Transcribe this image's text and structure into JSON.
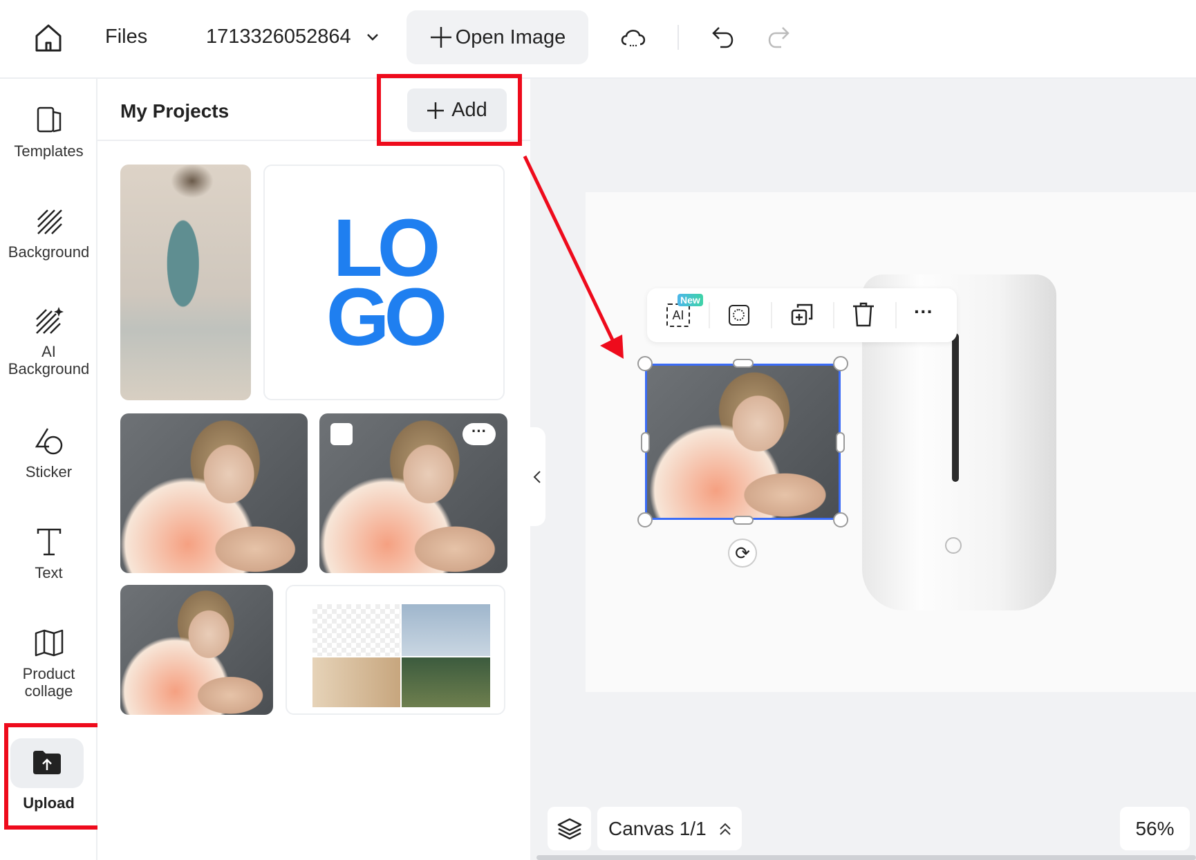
{
  "topbar": {
    "files": "Files",
    "project_name": "1713326052864",
    "open_image": "Open Image"
  },
  "sidebar": {
    "items": [
      {
        "label": "Templates",
        "icon": "templates-icon"
      },
      {
        "label": "Background",
        "icon": "background-icon"
      },
      {
        "label": "AI\nBackground",
        "l1": "AI",
        "l2": "Background",
        "icon": "ai-background-icon"
      },
      {
        "label": "Sticker",
        "icon": "sticker-icon"
      },
      {
        "label": "Text",
        "icon": "text-icon"
      },
      {
        "label": "Product collage",
        "l1": "Product",
        "l2": "collage",
        "icon": "product-collage-icon"
      },
      {
        "label": "Upload",
        "icon": "upload-icon",
        "active": true
      }
    ]
  },
  "panel": {
    "title": "My Projects",
    "add_label": "Add",
    "logo_text": [
      "LO",
      "GO"
    ]
  },
  "toolbar": {
    "new_badge": "New",
    "ai_label": "AI"
  },
  "bottom": {
    "canvas_label": "Canvas 1/1",
    "zoom": "56%"
  },
  "colors": {
    "accent": "#3b6cf6",
    "highlight": "#ee0b1c",
    "logo": "#1f7ff0",
    "new_badge": "#3cc9c2"
  }
}
